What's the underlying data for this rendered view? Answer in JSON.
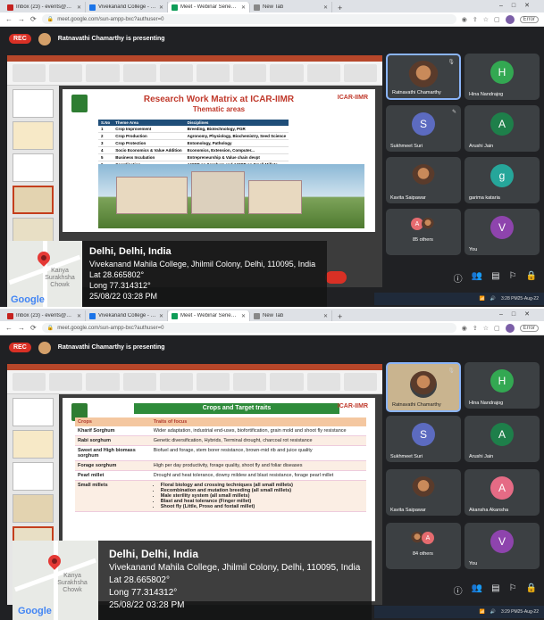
{
  "browser": {
    "tabs": [
      {
        "label": "Inbox (23) - events@viveksna...",
        "color": "#c5221f"
      },
      {
        "label": "Vivekanand College - Calenda...",
        "color": "#1a73e8"
      },
      {
        "label": "Meet - Webinar Series 01/1...",
        "color": "#0f9d58"
      },
      {
        "label": "New Tab",
        "color": "#888888"
      }
    ],
    "url": "meet.google.com/sun-ampp-bxc?authuser=0",
    "error_label": "Error"
  },
  "meet": {
    "rec_label": "REC",
    "presenting_text": "Ratnavathi Chamarthy is presenting"
  },
  "slide1": {
    "title": "Research Work Matrix at ICAR-IIMR",
    "subtitle": "Thematic areas",
    "logo_right": "ICAR-IIMR",
    "header": [
      "S.No",
      "Theme Area",
      "Disciplines"
    ],
    "rows": [
      [
        "1",
        "Crop Improvement",
        "Breeding, Biotechnology, PGR"
      ],
      [
        "2",
        "Crop Production",
        "Agronomy, Physiology, Biochemistry, Seed Science"
      ],
      [
        "3",
        "Crop Protection",
        "Entomology, Pathology"
      ],
      [
        "4",
        "Socio Economics & Value Addition",
        "Economics, Extension, Computer..."
      ],
      [
        "5",
        "Business Incubation",
        "Entrepreneurship & Value chain devpt"
      ],
      [
        "6",
        "Coordination",
        "AICRP on Sorghum and AICRP on Small Millets"
      ]
    ]
  },
  "slide2": {
    "title": "Crops and Target traits",
    "logo_right": "ICAR-IIMR",
    "header": [
      "Crops",
      "Traits of focus"
    ],
    "rows": [
      {
        "crop": "Kharif Sorghum",
        "traits": "Wider adaptation, industrial end-uses, biofortification, grain mold and shoot fly resistance"
      },
      {
        "crop": "Rabi sorghum",
        "traits": "Genetic diversification, Hybrids, Terminal drought, charcoal rot resistance"
      },
      {
        "crop": "Sweet and High biomass sorghum",
        "traits": "Biofuel and forage, stem borer resistance, brown-mid rib and juice quality"
      },
      {
        "crop": "Forage sorghum",
        "traits": "High per day productivity, forage quality, shoot fly and foliar diseases"
      },
      {
        "crop": "Pearl millet",
        "traits": "Drought and heat tolerance, downy mildew and blast resistance, forage pearl millet"
      }
    ],
    "small_millets": {
      "crop": "Small millets",
      "bullets": [
        "Floral biology and crossing techniques (all small millets)",
        "Recombination and mutation breeding (all small millets)",
        "Male sterility system (all small millets)",
        "Blast and heat tolerance (Finger millet)",
        "Shoot fly (Little, Proso and foxtail millet)"
      ]
    }
  },
  "participants1": [
    {
      "name": "Ratnavathi Chamarthy",
      "initial": "",
      "color": "#3c4043"
    },
    {
      "name": "Hina Nandrajog",
      "initial": "H",
      "color": "#33a852"
    },
    {
      "name": "Sukhmeet Suri",
      "initial": "S",
      "color": "#5c6bc0"
    },
    {
      "name": "Arushi Jain",
      "initial": "A",
      "color": "#1e7f4a"
    },
    {
      "name": "Kavita Saipawar",
      "initial": "",
      "color": "#3c4043"
    },
    {
      "name": "garima kataria",
      "initial": "g",
      "color": "#26a69a"
    },
    {
      "name": "85 others",
      "initial": "A",
      "color": "#e56b6f"
    },
    {
      "name": "You",
      "initial": "V",
      "color": "#8e44ad"
    }
  ],
  "participants2": [
    {
      "name": "Ratnavathi Chamarthy",
      "initial": "",
      "color": "#3c4043"
    },
    {
      "name": "Hina Nandrajog",
      "initial": "H",
      "color": "#33a852"
    },
    {
      "name": "Sukhmeet Suri",
      "initial": "S",
      "color": "#5c6bc0"
    },
    {
      "name": "Arushi Jain",
      "initial": "A",
      "color": "#1e7f4a"
    },
    {
      "name": "Kavita Saipawar",
      "initial": "",
      "color": "#3c4043"
    },
    {
      "name": "Akansha Akansha",
      "initial": "A",
      "color": "#e56b85"
    },
    {
      "name": "84 others",
      "initial": "A",
      "color": "#e56b6f"
    },
    {
      "name": "You",
      "initial": "V",
      "color": "#8e44ad"
    }
  ],
  "gps": {
    "city": "Delhi, Delhi, India",
    "address": "Vivekanand Mahila College, Jhilmil Colony, Delhi, 110095, India",
    "lat": "Lat 28.665802°",
    "long": "Long 77.314312°",
    "datetime": "25/08/22 03:28 PM",
    "place_label": "Kanya Surakhsha Chowk",
    "map_logo": "Google"
  },
  "taskbar": {
    "time1": "3:28 PM",
    "time2": "3:29 PM",
    "date": "25-Aug-22"
  },
  "icons": [
    "mic-icon",
    "participants-icon",
    "chat-icon",
    "activities-icon",
    "lock-icon",
    "info-icon",
    "map-pin-icon"
  ]
}
